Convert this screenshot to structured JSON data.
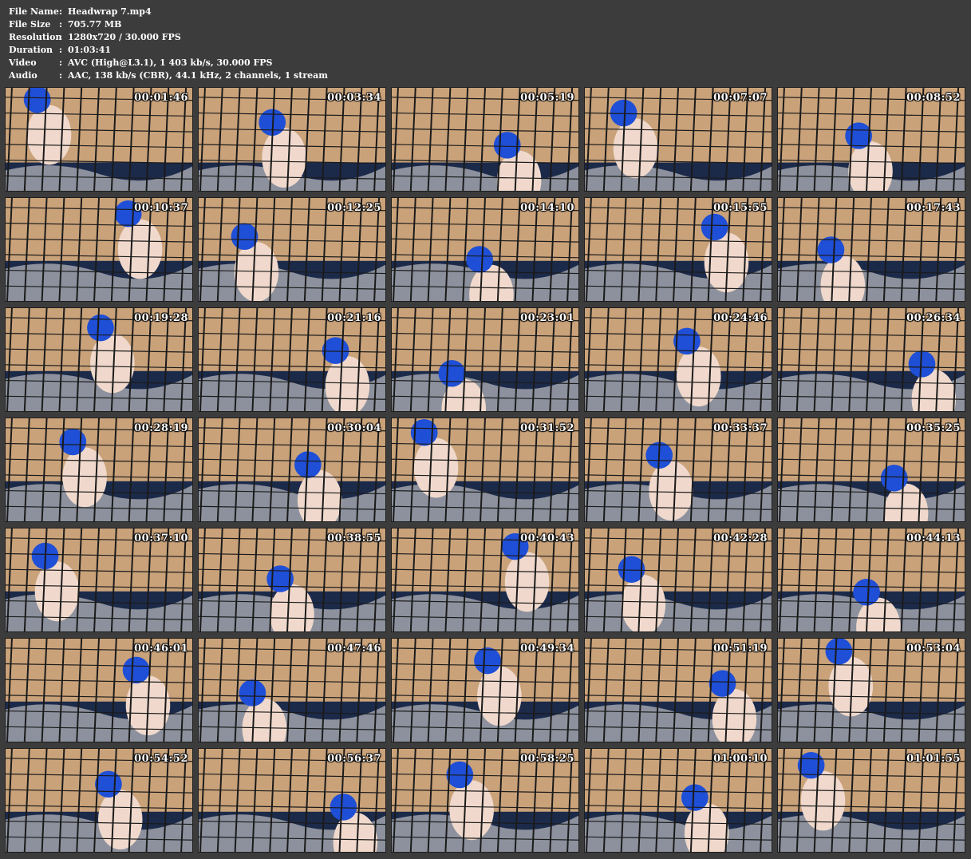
{
  "info": [
    {
      "label": "File Name",
      "value": "Headwrap 7.mp4"
    },
    {
      "label": "File Size",
      "value": "705.77 MB"
    },
    {
      "label": "Resolution",
      "value": "1280x720 / 30.000 FPS"
    },
    {
      "label": "Duration",
      "value": "01:03:41"
    },
    {
      "label": "Video",
      "value": "AVC (High@L3.1), 1 403 kb/s, 30.000 FPS"
    },
    {
      "label": "Audio",
      "value": "AAC, 138 kb/s (CBR), 44.1 kHz, 2 channels, 1 stream"
    }
  ],
  "separator": ":",
  "thumbnails": [
    {
      "time": "00:01:46"
    },
    {
      "time": "00:03:34"
    },
    {
      "time": "00:05:19"
    },
    {
      "time": "00:07:07"
    },
    {
      "time": "00:08:52"
    },
    {
      "time": "00:10:37"
    },
    {
      "time": "00:12:25"
    },
    {
      "time": "00:14:10"
    },
    {
      "time": "00:15:55"
    },
    {
      "time": "00:17:43"
    },
    {
      "time": "00:19:28"
    },
    {
      "time": "00:21:16"
    },
    {
      "time": "00:23:01"
    },
    {
      "time": "00:24:46"
    },
    {
      "time": "00:26:34"
    },
    {
      "time": "00:28:19"
    },
    {
      "time": "00:30:04"
    },
    {
      "time": "00:31:52"
    },
    {
      "time": "00:33:37"
    },
    {
      "time": "00:35:25"
    },
    {
      "time": "00:37:10"
    },
    {
      "time": "00:38:55"
    },
    {
      "time": "00:40:43"
    },
    {
      "time": "00:42:28"
    },
    {
      "time": "00:44:13"
    },
    {
      "time": "00:46:01"
    },
    {
      "time": "00:47:46"
    },
    {
      "time": "00:49:34"
    },
    {
      "time": "00:51:19"
    },
    {
      "time": "00:53:04"
    },
    {
      "time": "00:54:52"
    },
    {
      "time": "00:56:37"
    },
    {
      "time": "00:58:25"
    },
    {
      "time": "01:00:10"
    },
    {
      "time": "01:01:55"
    }
  ],
  "colors": {
    "background": "#3c3c3c",
    "wall": "#c9a27a",
    "blanket": "#1c2a4a",
    "hood": "#1f4fd6",
    "cage": "#1a1a1a"
  }
}
